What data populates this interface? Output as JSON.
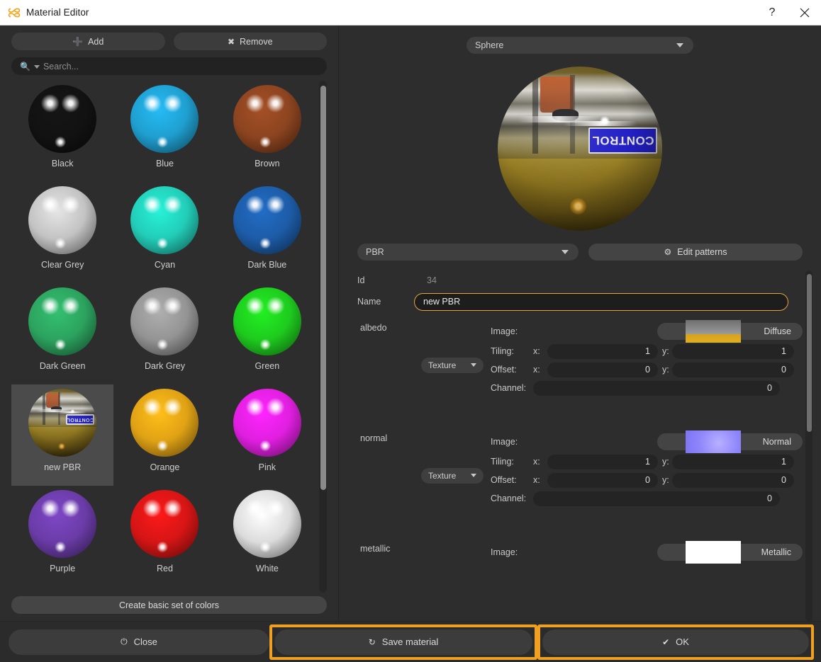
{
  "window": {
    "title": "Material Editor",
    "logo_icon": "material-editor-logo-icon",
    "help_label": "?",
    "close_label": "✕",
    "accent_color": "#f0a020",
    "bg_color": "#2d2d2d"
  },
  "left_panel": {
    "add_button": {
      "label": "Add",
      "icon": "plus-icon"
    },
    "remove_button": {
      "label": "Remove",
      "icon": "cross-icon"
    },
    "search": {
      "placeholder": "Search...",
      "value": "",
      "icon": "search-icon",
      "filter_icon": "chevron-down-icon"
    },
    "create_basic_button": {
      "label": "Create basic set of colors"
    },
    "selected_material": "new PBR",
    "materials": [
      {
        "label": "Black",
        "color": "#121212",
        "type": "color"
      },
      {
        "label": "Blue",
        "color": "#1f9fd0",
        "type": "color"
      },
      {
        "label": "Brown",
        "color": "#8c4420",
        "type": "color"
      },
      {
        "label": "Clear Grey",
        "color": "#c3c3c3",
        "type": "color"
      },
      {
        "label": "Cyan",
        "color": "#22cdb8",
        "type": "color"
      },
      {
        "label": "Dark Blue",
        "color": "#1d5ca8",
        "type": "color"
      },
      {
        "label": "Dark Green",
        "color": "#2ca35f",
        "type": "color"
      },
      {
        "label": "Dark Grey",
        "color": "#949494",
        "type": "color"
      },
      {
        "label": "Green",
        "color": "#1ecb1e",
        "type": "color"
      },
      {
        "label": "new PBR",
        "color": "#8a7a3a",
        "type": "texture"
      },
      {
        "label": "Orange",
        "color": "#e0a215",
        "type": "color"
      },
      {
        "label": "Pink",
        "color": "#e01fe0",
        "type": "color"
      },
      {
        "label": "Purple",
        "color": "#6b3ca8",
        "type": "color"
      },
      {
        "label": "Red",
        "color": "#d61515",
        "type": "color"
      },
      {
        "label": "White",
        "color": "#dcdcdc",
        "type": "color"
      }
    ],
    "scrollbar": {
      "thumb_top_pct": 1,
      "thumb_height_pct": 79
    }
  },
  "right_panel": {
    "shape_selector": {
      "value": "Sphere",
      "icon": "chevron-down-icon"
    },
    "preview": {
      "material": "new PBR",
      "decal_text": "CONTROL"
    },
    "shader_selector": {
      "value": "PBR",
      "icon": "chevron-down-icon"
    },
    "edit_patterns_button": {
      "label": "Edit patterns",
      "icon": "gear-icon"
    },
    "fields": {
      "id_label": "Id",
      "id_value": "34",
      "name_label": "Name",
      "name_value": "new PBR"
    },
    "maps": [
      {
        "title": "albedo",
        "type_selector": {
          "value": "Texture",
          "icon": "chevron-down-icon"
        },
        "image_label": "Image:",
        "image_name": "Diffuse",
        "image_thumb": "diffuse-texture-thumbnail",
        "tiling_label": "Tiling:",
        "tiling_x_label": "x:",
        "tiling_x": "1",
        "tiling_y_label": "y:",
        "tiling_y": "1",
        "offset_label": "Offset:",
        "offset_x_label": "x:",
        "offset_x": "0",
        "offset_y_label": "y:",
        "offset_y": "0",
        "channel_label": "Channel:",
        "channel": "0"
      },
      {
        "title": "normal",
        "type_selector": {
          "value": "Texture",
          "icon": "chevron-down-icon"
        },
        "image_label": "Image:",
        "image_name": "Normal",
        "image_thumb": "normal-map-thumbnail",
        "tiling_label": "Tiling:",
        "tiling_x_label": "x:",
        "tiling_x": "1",
        "tiling_y_label": "y:",
        "tiling_y": "1",
        "offset_label": "Offset:",
        "offset_x_label": "x:",
        "offset_x": "0",
        "offset_y_label": "y:",
        "offset_y": "0",
        "channel_label": "Channel:",
        "channel": "0"
      }
    ],
    "metallic": {
      "title": "metallic",
      "image_label": "Image:",
      "image_name": "Metallic",
      "image_thumb": "metallic-map-thumbnail"
    },
    "scrollbar": {
      "thumb_top_pct": 1,
      "thumb_height_pct": 45
    }
  },
  "footer": {
    "close_button": {
      "label": "Close",
      "icon": "power-icon",
      "highlighted": false
    },
    "save_button": {
      "label": "Save material",
      "icon": "refresh-icon",
      "highlighted": true
    },
    "ok_button": {
      "label": "OK",
      "icon": "check-icon",
      "highlighted": true
    }
  }
}
